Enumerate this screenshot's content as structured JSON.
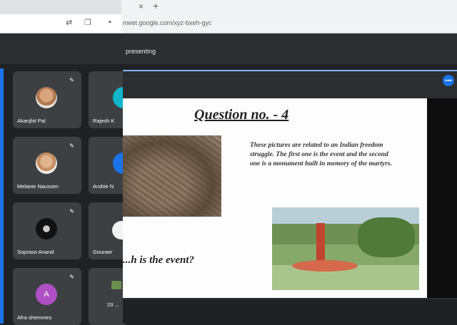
{
  "browser": {
    "tab_close": "×",
    "tab_new": "+",
    "url": "meet.google.com/xyz-bxeh-gyc",
    "icons": [
      "translate-icon",
      "bookmark-icon",
      "lock-icon"
    ]
  },
  "meet": {
    "presenting_label": "presenting"
  },
  "participants": [
    {
      "name": "Akanjhit Pal"
    },
    {
      "name": "Rajesh K"
    },
    {
      "name": "Melanie Naussen"
    },
    {
      "name": "Andrie N"
    },
    {
      "name": "Sopraso Anand"
    },
    {
      "name": "Gouraer"
    },
    {
      "name": "Afra shemmes",
      "initial": "A"
    },
    {
      "name": "23 ..."
    }
  ],
  "slide": {
    "title": "Question no. - 4",
    "text": "These pictures are related to an Indian freedom struggle. The first one is the event and the second one is a monument built in memory of the martyrs.",
    "question": "...h is the event?"
  },
  "colors": {
    "accent": "#1a73e8",
    "tile": "#3c4043",
    "panel": "#2c2d31"
  }
}
